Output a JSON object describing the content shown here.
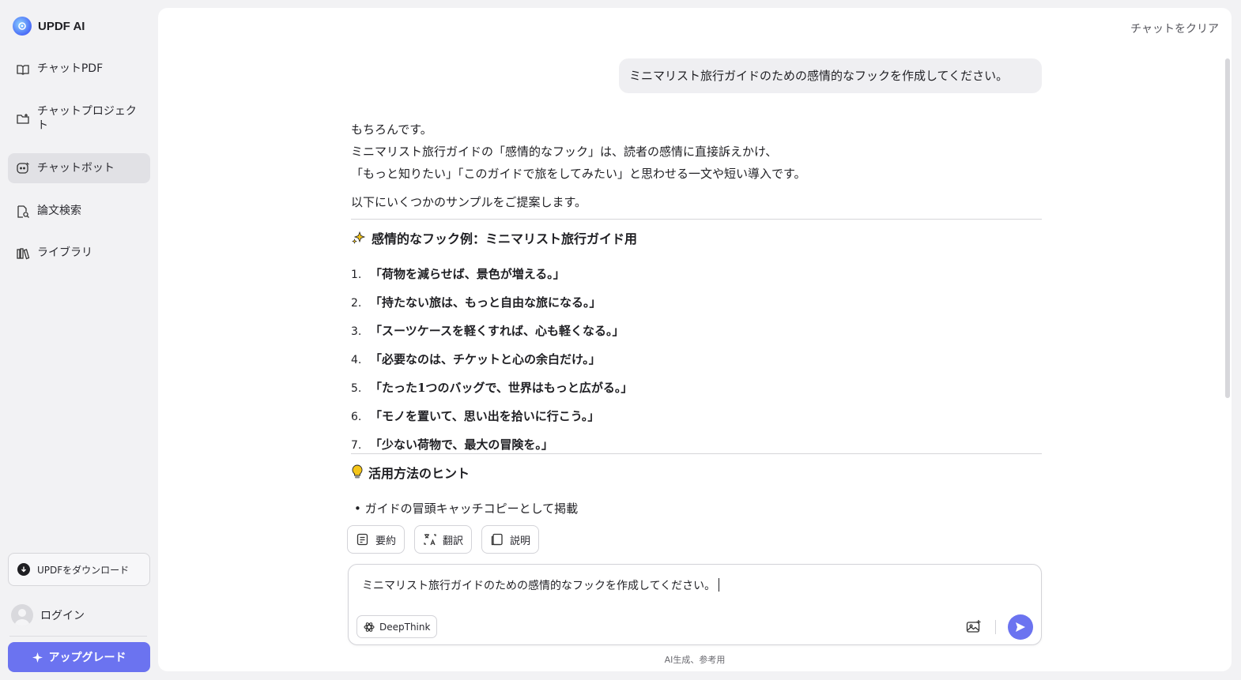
{
  "app": {
    "name": "UPDF AI"
  },
  "sidebar": {
    "items": [
      {
        "label": "チャットPDF",
        "icon": "book-icon"
      },
      {
        "label": "チャットプロジェクト",
        "icon": "folder-icon"
      },
      {
        "label": "チャットボット",
        "icon": "bot-icon",
        "active": true
      },
      {
        "label": "論文検索",
        "icon": "doc-search-icon"
      },
      {
        "label": "ライブラリ",
        "icon": "library-icon"
      }
    ],
    "download_label": "UPDFをダウンロード",
    "login_label": "ログイン",
    "upgrade_label": "アップグレード"
  },
  "header": {
    "clear_label": "チャットをクリア"
  },
  "chat": {
    "user_message": "ミニマリスト旅行ガイドのための感情的なフックを作成してください。",
    "answer": {
      "intro1": "もちろんです。",
      "intro2": "ミニマリスト旅行ガイドの「感情的なフック」は、読者の感情に直接訴えかけ、",
      "intro3": "「もっと知りたい」「このガイドで旅をしてみたい」と思わせる一文や短い導入です。",
      "intro4": "以下にいくつかのサンプルをご提案します。",
      "section1_title": "感情的なフック例：ミニマリスト旅行ガイド用",
      "hooks": [
        "「荷物を減らせば、景色が増える。」",
        "「持たない旅は、もっと自由な旅になる。」",
        "「スーツケースを軽くすれば、心も軽くなる。」",
        "「必要なのは、チケットと心の余白だけ。」",
        "「たった1つのバッグで、世界はもっと広がる。」",
        "「モノを置いて、思い出を拾いに行こう。」",
        "「少ない荷物で、最大の冒険を。」"
      ],
      "section2_title": "活用方法のヒント",
      "tips": [
        "ガイドの冒頭キャッチコピーとして掲載"
      ]
    },
    "actions": {
      "summary": "要約",
      "translate": "翻訳",
      "explain": "説明"
    }
  },
  "composer": {
    "text": "ミニマリスト旅行ガイドのための感情的なフックを作成してください。",
    "deepthink_label": "DeepThink",
    "footnote": "AI生成、参考用"
  },
  "colors": {
    "accent": "#6b73f0",
    "active_nav": "#e1e1e5",
    "background": "#f2f2f4"
  }
}
